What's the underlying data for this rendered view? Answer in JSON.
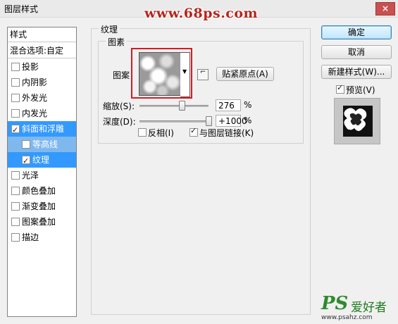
{
  "window": {
    "title": "图层样式",
    "close_glyph": "×"
  },
  "watermarks": {
    "top": "www.68ps.com",
    "bottom_logo": "PS",
    "bottom_text": "爱好者",
    "bottom_url": "www.psahz.com"
  },
  "style_list": {
    "header": "样式",
    "blend_options": "混合选项:自定",
    "items": [
      {
        "label": "投影",
        "checked": false
      },
      {
        "label": "内阴影",
        "checked": false
      },
      {
        "label": "外发光",
        "checked": false
      },
      {
        "label": "内发光",
        "checked": false
      },
      {
        "label": "斜面和浮雕",
        "checked": true
      },
      {
        "label": "等高线",
        "checked": false
      },
      {
        "label": "纹理",
        "checked": true
      },
      {
        "label": "光泽",
        "checked": false
      },
      {
        "label": "颜色叠加",
        "checked": false
      },
      {
        "label": "渐变叠加",
        "checked": false
      },
      {
        "label": "图案叠加",
        "checked": false
      },
      {
        "label": "描边",
        "checked": false
      }
    ]
  },
  "texture_panel": {
    "section_title": "纹理",
    "group_title": "图素",
    "pattern_label": "图案",
    "snap_button": "贴紧原点(A)",
    "scale_label": "缩放(S):",
    "scale_value": "276",
    "scale_unit": "%",
    "scale_level_percent": 276,
    "depth_label": "深度(D):",
    "depth_value": "+1000",
    "depth_unit": "%",
    "depth_level_percent": 1000,
    "invert_label": "反相(I)",
    "invert_checked": false,
    "link_label": "与图层链接(K)",
    "link_checked": true
  },
  "buttons": {
    "ok": "确定",
    "cancel": "取消",
    "new_style": "新建样式(W)..."
  },
  "preview": {
    "label": "预览(V)",
    "checked": true
  },
  "colors": {
    "selection": "#3399ff",
    "highlight_border": "#d9191f",
    "watermark_red": "#b8241c",
    "watermark_green": "#2d8b2d"
  },
  "icons": [
    "close-icon",
    "dropdown-arrow-icon",
    "new-preset-icon",
    "checkbox-icon"
  ]
}
